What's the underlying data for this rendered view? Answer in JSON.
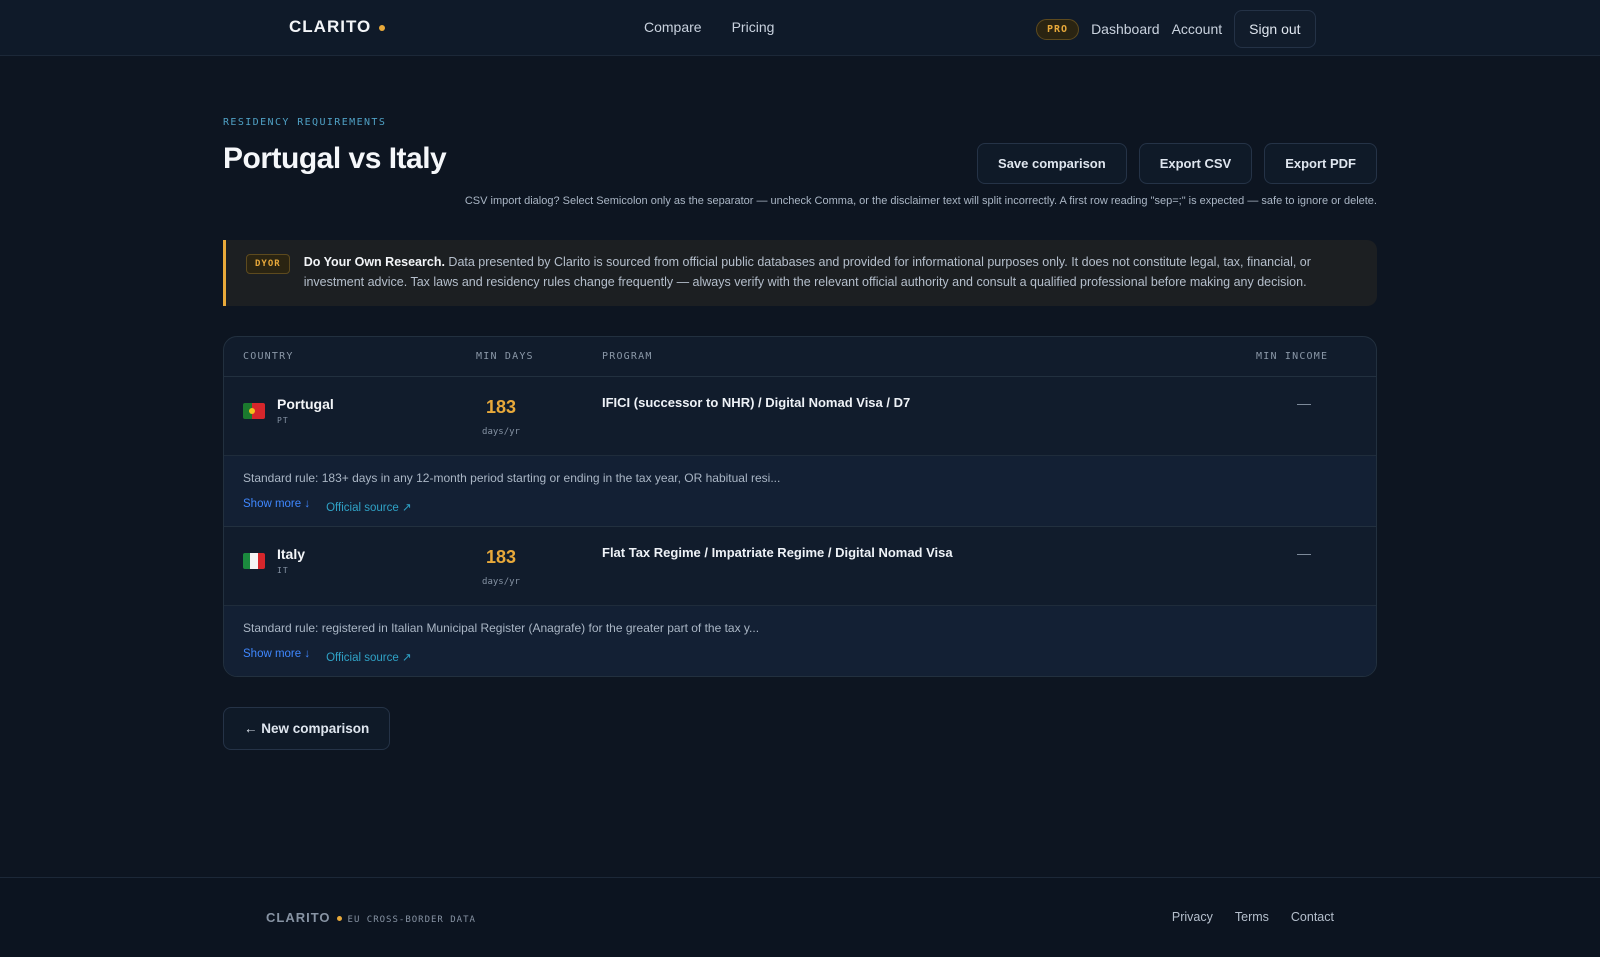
{
  "header": {
    "logo": "CLARITO",
    "nav": [
      "Compare",
      "Pricing"
    ],
    "pro_badge": "PRO",
    "dashboard": "Dashboard",
    "account": "Account",
    "signout": "Sign out"
  },
  "page": {
    "eyebrow": "RESIDENCY REQUIREMENTS",
    "title": "Portugal vs Italy",
    "actions": {
      "save": "Save comparison",
      "export_csv": "Export CSV",
      "export_pdf": "Export PDF"
    },
    "csv_note": "CSV import dialog? Select Semicolon only as the separator — uncheck Comma, or the disclaimer text will split incorrectly. A first row reading \"sep=;\" is expected — safe to ignore or delete."
  },
  "disclaimer": {
    "tag": "DYOR",
    "heading": "Do Your Own Research.",
    "body": " Data presented by Clarito is sourced from official public databases and provided for informational purposes only. It does not constitute legal, tax, financial, or investment advice. Tax laws and residency rules change frequently — always verify with the relevant official authority and consult a qualified professional before making any decision."
  },
  "table": {
    "columns": {
      "country": "COUNTRY",
      "min_days": "MIN DAYS",
      "program": "PROGRAM",
      "min_income": "MIN INCOME"
    },
    "rows": [
      {
        "country": "Portugal",
        "code": "PT",
        "days": "183",
        "days_unit": "days/yr",
        "program": "IFICI (successor to NHR) / Digital Nomad Visa / D7",
        "income": "—",
        "rule": "Standard rule: 183+ days in any 12-month period starting or ending in the tax year, OR habitual resi...",
        "show_more": "Show more ↓",
        "official": "Official source ↗"
      },
      {
        "country": "Italy",
        "code": "IT",
        "days": "183",
        "days_unit": "days/yr",
        "program": "Flat Tax Regime / Impatriate Regime / Digital Nomad Visa",
        "income": "—",
        "rule": "Standard rule: registered in Italian Municipal Register (Anagrafe) for the greater part of the tax y...",
        "show_more": "Show more ↓",
        "official": "Official source ↗"
      }
    ]
  },
  "new_comparison": "← New comparison",
  "footer": {
    "brand": "CLARITO",
    "tagline": "EU CROSS-BORDER DATA",
    "links": [
      "Privacy",
      "Terms",
      "Contact"
    ]
  },
  "colors": {
    "accent": "#e8a93a",
    "link": "#3f87ff",
    "background": "#0d1521"
  }
}
